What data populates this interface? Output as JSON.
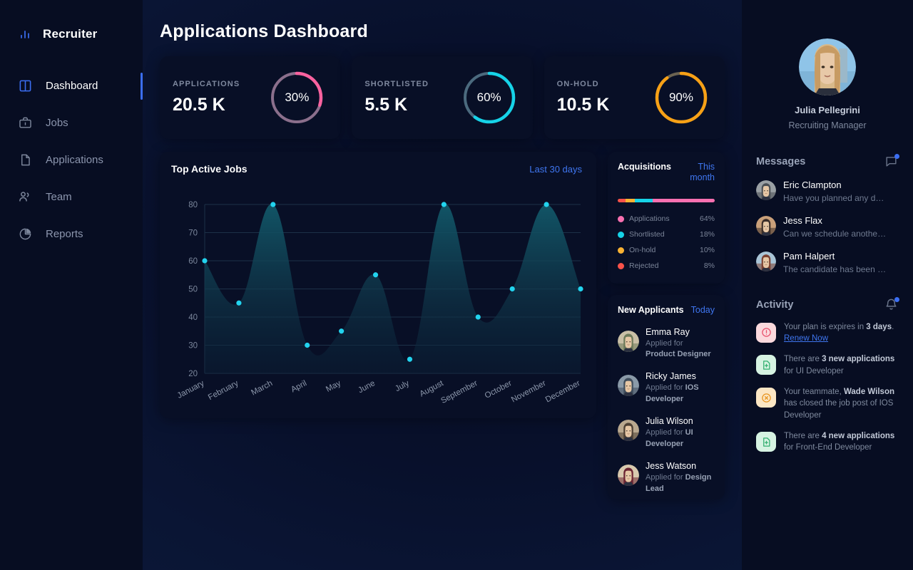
{
  "brand": {
    "name": "Recruiter",
    "icon": "bar-chart-icon"
  },
  "sidebar": {
    "items": [
      {
        "label": "Dashboard",
        "icon": "layout-dashboard-icon",
        "active": true
      },
      {
        "label": "Jobs",
        "icon": "briefcase-icon",
        "active": false
      },
      {
        "label": "Applications",
        "icon": "document-icon",
        "active": false
      },
      {
        "label": "Team",
        "icon": "users-icon",
        "active": false
      },
      {
        "label": "Reports",
        "icon": "pie-chart-icon",
        "active": false
      }
    ]
  },
  "header": {
    "title": "Applications Dashboard"
  },
  "stats": [
    {
      "label": "APPLICATIONS",
      "value": "20.5 K",
      "percent_label": "30%",
      "percent": 30,
      "color": "#f9629f",
      "track": "#8b6f8c"
    },
    {
      "label": "SHORTLISTED",
      "value": "5.5 K",
      "percent_label": "60%",
      "percent": 60,
      "color": "#16d3e8",
      "track": "#4b6a7e"
    },
    {
      "label": "ON-HOLD",
      "value": "10.5 K",
      "percent_label": "90%",
      "percent": 90,
      "color": "#f7a116",
      "track": "#6b6351"
    }
  ],
  "chart_card": {
    "title": "Top Active Jobs",
    "range_label": "Last 30 days"
  },
  "chart_data": {
    "type": "area",
    "title": "Top Active Jobs",
    "xlabel": "",
    "ylabel": "",
    "categories": [
      "January",
      "February",
      "March",
      "April",
      "May",
      "June",
      "July",
      "August",
      "September",
      "October",
      "November",
      "December"
    ],
    "values": [
      60,
      45,
      80,
      30,
      35,
      55,
      25,
      80,
      40,
      50,
      80,
      50
    ],
    "series": [
      {
        "name": "Active Jobs",
        "values": [
          60,
          45,
          80,
          30,
          35,
          55,
          25,
          80,
          40,
          50,
          80,
          50
        ]
      }
    ],
    "yticks": [
      20,
      30,
      40,
      50,
      60,
      70,
      80
    ],
    "ylim": [
      20,
      80
    ],
    "grid": true,
    "legend": "none",
    "line_color": "#22d3ee",
    "point_color": "#22d3ee",
    "fill_top": "#0f4a58",
    "fill_bottom": "#0a1a33"
  },
  "acquisitions": {
    "title": "Acquisitions",
    "range_label": "This month",
    "stack": [
      {
        "color": "#f9524a",
        "percent": 8
      },
      {
        "color": "#f9b233",
        "percent": 10
      },
      {
        "color": "#16d3e8",
        "percent": 18
      },
      {
        "color": "#f970b0",
        "percent": 64
      }
    ],
    "legend": [
      {
        "label": "Applications",
        "value": "64%",
        "color": "#f970b0"
      },
      {
        "label": "Shortlisted",
        "value": "18%",
        "color": "#16d3e8"
      },
      {
        "label": "On-hold",
        "value": "10%",
        "color": "#f9b233"
      },
      {
        "label": "Rejected",
        "value": "8%",
        "color": "#f9524a"
      }
    ]
  },
  "new_applicants": {
    "title": "New Applicants",
    "range_label": "Today",
    "items": [
      {
        "name": "Emma Ray",
        "applied_label": "Applied for",
        "role": "Product Designer",
        "avatar_colors": [
          "#c9bfa6",
          "#6d7a5a"
        ]
      },
      {
        "name": "Ricky James",
        "applied_label": "Applied for",
        "role": "IOS Developer",
        "avatar_colors": [
          "#8a9aa8",
          "#3f4d5c"
        ]
      },
      {
        "name": "Julia Wilson",
        "applied_label": "Applied for",
        "role": "UI Developer",
        "avatar_colors": [
          "#b9a88f",
          "#4d4034"
        ]
      },
      {
        "name": "Jess Watson",
        "applied_label": "Applied for",
        "role": "Design Lead",
        "avatar_colors": [
          "#d8c9ae",
          "#6b2432"
        ]
      }
    ]
  },
  "profile": {
    "name": "Julia Pellegrini",
    "role": "Recruiting Manager",
    "avatar_colors": [
      "#8fc4e8",
      "#c79b63"
    ]
  },
  "messages": {
    "title": "Messages",
    "icon": "chat-bubble-icon",
    "has_badge": true,
    "items": [
      {
        "name": "Eric Clampton",
        "preview": "Have you planned any d…",
        "avatar_colors": [
          "#9aa0a4",
          "#4a4f54"
        ]
      },
      {
        "name": "Jess Flax",
        "preview": "Can we schedule anothe…",
        "avatar_colors": [
          "#c9a07a",
          "#3a2d28"
        ]
      },
      {
        "name": "Pam Halpert",
        "preview": "The candidate has been …",
        "avatar_colors": [
          "#a9c4d6",
          "#7a4030"
        ]
      }
    ]
  },
  "activity": {
    "title": "Activity",
    "icon": "bell-icon",
    "has_badge": true,
    "items": [
      {
        "icon": "alert-circle-icon",
        "icon_bg": "#fbd9dd",
        "icon_color": "#e8506b",
        "text_before": "Your plan is expires in ",
        "bold": "3 days",
        "text_after": ".",
        "link": "Renew Now"
      },
      {
        "icon": "document-plus-icon",
        "icon_bg": "#d6f3e2",
        "icon_color": "#2fae6e",
        "text_before": "There are ",
        "bold": "3 new applications",
        "text_after": " for UI Developer",
        "link": ""
      },
      {
        "icon": "close-circle-icon",
        "icon_bg": "#fbe6c4",
        "icon_color": "#e8941f",
        "text_before": "Your teammate, ",
        "bold": "Wade Wilson",
        "text_after": " has closed the job post of IOS Developer",
        "link": ""
      },
      {
        "icon": "document-plus-icon",
        "icon_bg": "#d6f3e2",
        "icon_color": "#2fae6e",
        "text_before": "There are ",
        "bold": "4 new applications",
        "text_after": " for Front-End Developer",
        "link": ""
      }
    ]
  },
  "colors": {
    "accent_blue": "#3b6ef3",
    "panel": "#080f26",
    "sidebar": "#070d22",
    "cyan": "#22d3ee",
    "pink": "#f9629f",
    "orange": "#f7a116"
  }
}
